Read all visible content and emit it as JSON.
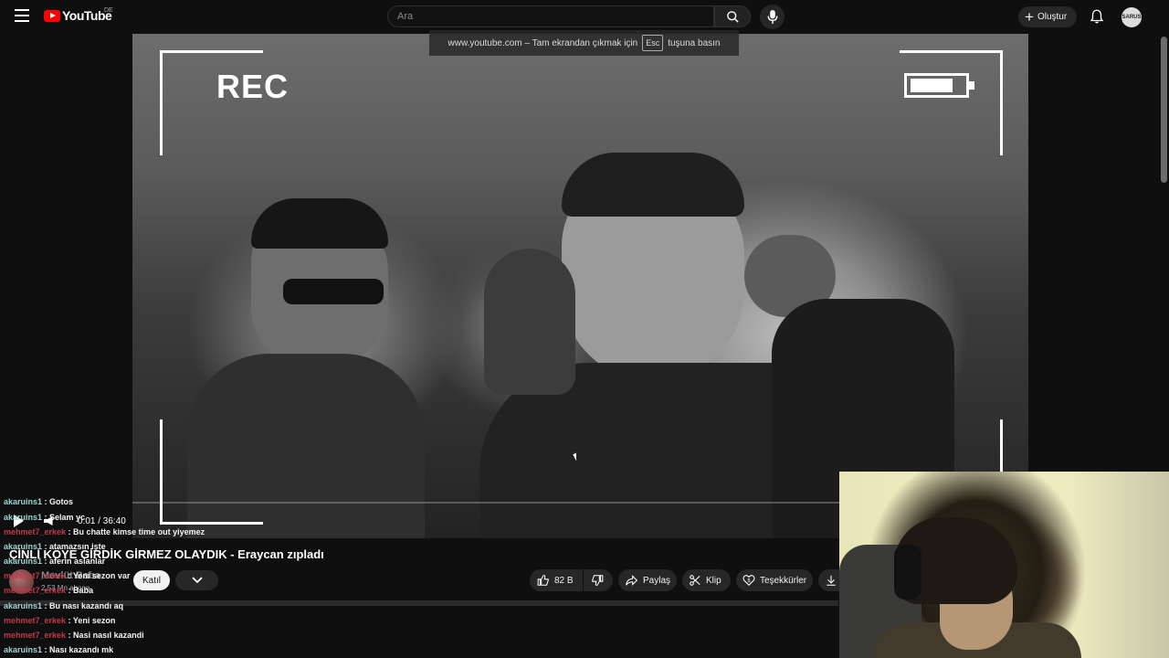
{
  "header": {
    "logo_text": "YouTube",
    "country": "DE",
    "search_placeholder": "Ara",
    "create_label": "Oluştur",
    "avatar_text": "SARUS"
  },
  "fullscreen_notice": {
    "prefix": "www.youtube.com – Tam ekrandan çıkmak için",
    "key": "Esc",
    "suffix": "tuşuna basın"
  },
  "video": {
    "overlay_rec": "REC",
    "time": "0:01 / 36:40",
    "title": "ÇİNLİ KÖYE GİRDİK GİRMEZ OLAYDIK - Eraycan zıpladı"
  },
  "channel": {
    "name": "Mevlüt Baba",
    "subscribers": "2,53 Mn abone",
    "join_label": "Katıl"
  },
  "actions": {
    "like_count": "82 B",
    "share_label": "Paylaş",
    "clip_label": "Klip",
    "thanks_label": "Teşekkürler"
  },
  "chat": [
    {
      "user": "akaruins1",
      "color": "cyan",
      "text": ": Gotos"
    },
    {
      "user": "akaruins1",
      "color": "cyan",
      "text": ": Selam yc"
    },
    {
      "user": "mehmet7_erkek",
      "color": "red",
      "text": ": Bu chatte kimse time out yiyemez"
    },
    {
      "user": "akaruins1",
      "color": "cyan",
      "text": ": atamazsın işte"
    },
    {
      "user": "akaruins1",
      "color": "cyan",
      "text": ": aferin aslanlar"
    },
    {
      "user": "mehmet7_erkek",
      "color": "red",
      "text": ": Yeni sezon var"
    },
    {
      "user": "mehmet7_erkek",
      "color": "red",
      "text": ": Baba"
    },
    {
      "user": "akaruins1",
      "color": "cyan",
      "text": ": Bu nası kazandı aq"
    },
    {
      "user": "mehmet7_erkek",
      "color": "red",
      "text": ": Yeni sezon"
    },
    {
      "user": "mehmet7_erkek",
      "color": "red",
      "text": ": Nasi nasıl kazandi"
    },
    {
      "user": "akaruins1",
      "color": "cyan",
      "text": ": Nası kazandı mk"
    }
  ],
  "colors": {
    "background": "#0f0f0f",
    "youtube_red": "#ff0000",
    "chat_cyan": "#9fd3d3",
    "chat_red": "#c0394a"
  }
}
